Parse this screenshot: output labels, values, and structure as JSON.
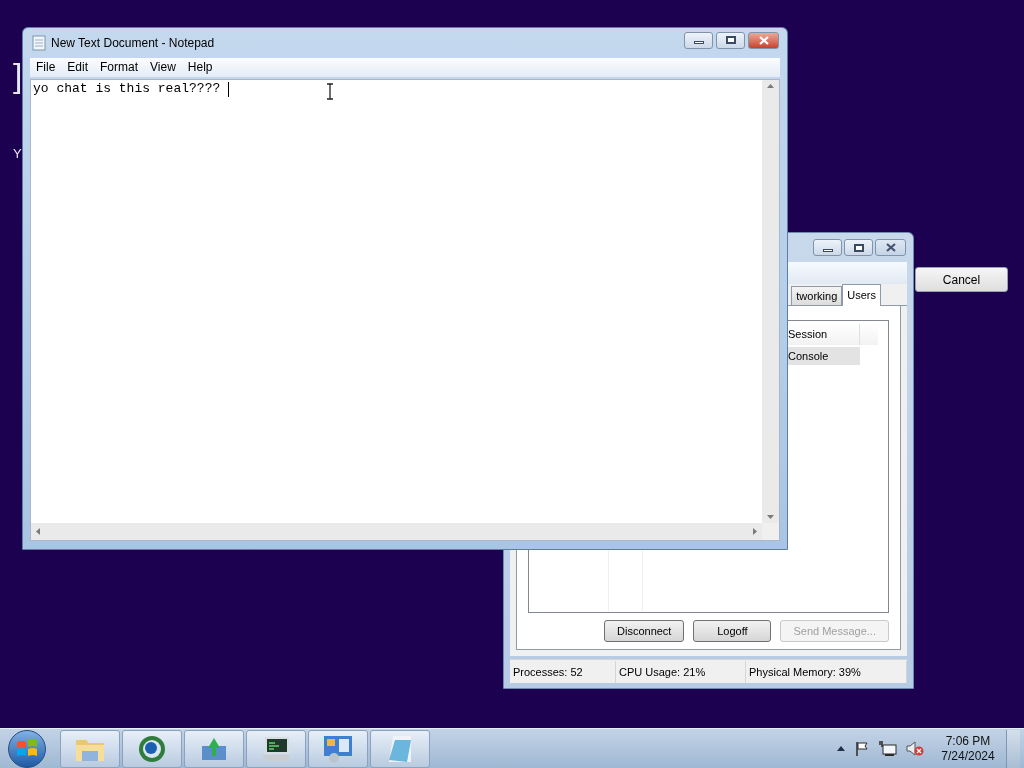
{
  "desktop": {
    "fragments": [
      "]",
      "Y"
    ]
  },
  "cancel_button": {
    "label": "Cancel"
  },
  "task_manager": {
    "tabs": [
      {
        "label": "tworking",
        "selected": false
      },
      {
        "label": "Users",
        "selected": true
      }
    ],
    "columns": [
      "Session"
    ],
    "rows": [
      {
        "session": "Console",
        "selected": true
      }
    ],
    "buttons": [
      {
        "label": "Disconnect",
        "disabled": false
      },
      {
        "label": "Logoff",
        "disabled": false
      },
      {
        "label": "Send Message...",
        "disabled": true
      }
    ],
    "status_bar": [
      "Processes: 52",
      "CPU Usage: 21%",
      "Physical Memory: 39%"
    ]
  },
  "notepad": {
    "title": "New Text Document - Notepad",
    "menu": [
      "File",
      "Edit",
      "Format",
      "View",
      "Help"
    ],
    "text": "yo chat is this real???? "
  },
  "taskbar": {
    "apps": [
      {
        "kind": "folder"
      },
      {
        "kind": "globe"
      },
      {
        "kind": "download"
      },
      {
        "kind": "monitor"
      },
      {
        "kind": "control-panel"
      },
      {
        "kind": "notepad"
      }
    ],
    "clock": {
      "time": "7:06 PM",
      "date": "7/24/2024"
    }
  }
}
